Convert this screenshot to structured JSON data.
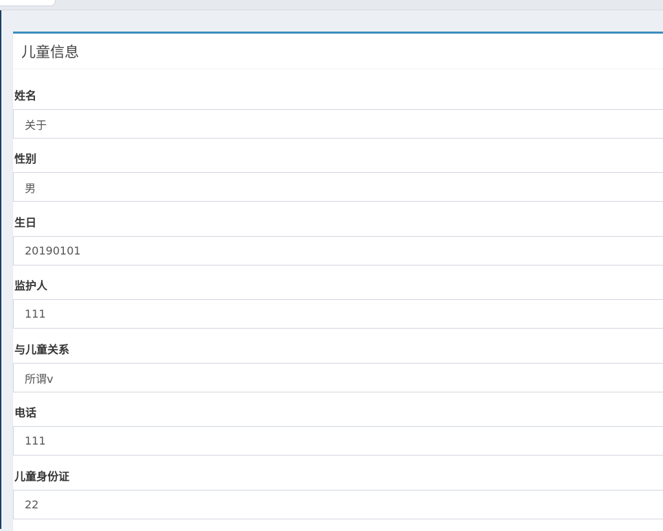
{
  "panel": {
    "title": "儿童信息"
  },
  "fields": [
    {
      "label": "姓名",
      "value": "关于"
    },
    {
      "label": "性别",
      "value": "男"
    },
    {
      "label": "生日",
      "value": "20190101"
    },
    {
      "label": "监护人",
      "value": "111"
    },
    {
      "label": "与儿童关系",
      "value": "所谓v"
    },
    {
      "label": "电话",
      "value": "111"
    },
    {
      "label": "儿童身份证",
      "value": "22"
    }
  ],
  "colors": {
    "accent": "#3c8dbc",
    "background": "#ecf0f5",
    "input_border": "#d2d6de",
    "sidebar": "#1f3f63"
  }
}
